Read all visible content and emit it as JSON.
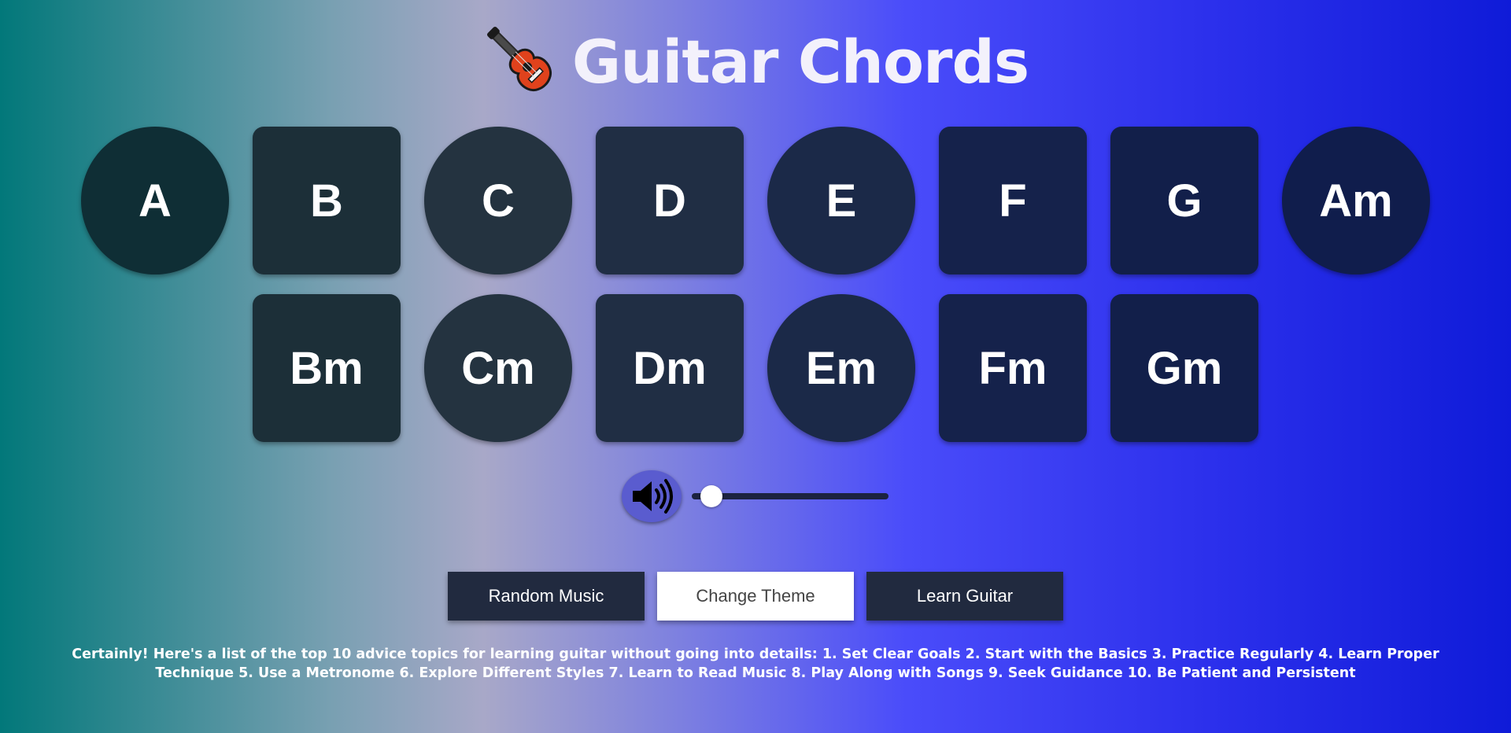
{
  "header": {
    "title": "Guitar Chords",
    "icon": "guitar-icon"
  },
  "chords_row1": [
    {
      "label": "A",
      "shape": "circle",
      "color": "#0f2e35"
    },
    {
      "label": "B",
      "shape": "square",
      "color": "#1c2f38"
    },
    {
      "label": "C",
      "shape": "circle",
      "color": "#243340"
    },
    {
      "label": "D",
      "shape": "square",
      "color": "#202e44"
    },
    {
      "label": "E",
      "shape": "circle",
      "color": "#1b2948"
    },
    {
      "label": "F",
      "shape": "square",
      "color": "#15224b"
    },
    {
      "label": "G",
      "shape": "square",
      "color": "#121f4a"
    },
    {
      "label": "Am",
      "shape": "circle",
      "color": "#101d4c"
    }
  ],
  "chords_row2": [
    {
      "label": "Bm",
      "shape": "square",
      "color": "#1c2f38"
    },
    {
      "label": "Cm",
      "shape": "circle",
      "color": "#243340"
    },
    {
      "label": "Dm",
      "shape": "square",
      "color": "#202e44"
    },
    {
      "label": "Em",
      "shape": "circle",
      "color": "#1b2948"
    },
    {
      "label": "Fm",
      "shape": "square",
      "color": "#15224b"
    },
    {
      "label": "Gm",
      "shape": "square",
      "color": "#121f4a"
    }
  ],
  "volume": {
    "icon": "speaker-volume-icon",
    "level": 0.1
  },
  "buttons": {
    "random_music": "Random Music",
    "change_theme": "Change Theme",
    "learn_guitar": "Learn Guitar"
  },
  "advice_text": "Certainly! Here's a list of the top 10 advice topics for learning guitar without going into details: 1. Set Clear Goals 2. Start with the Basics 3. Practice Regularly 4. Learn Proper Technique 5. Use a Metronome 6. Explore Different Styles 7. Learn to Read Music 8. Play Along with Songs 9. Seek Guidance 10. Be Patient and Persistent"
}
